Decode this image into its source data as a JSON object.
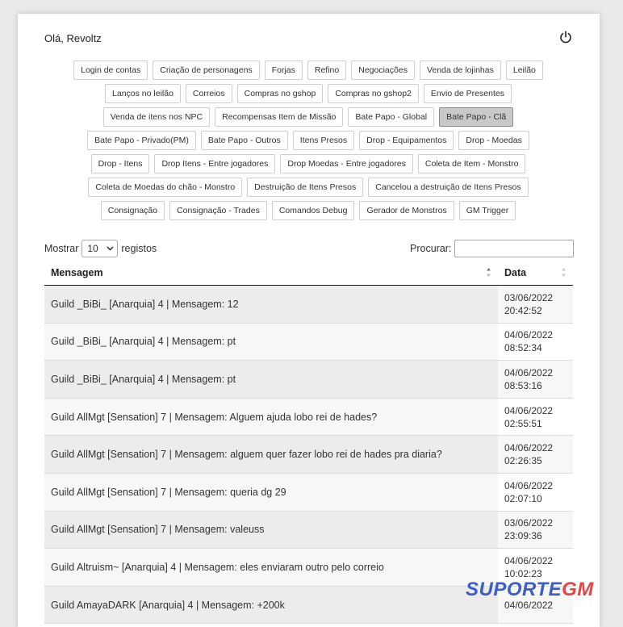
{
  "header": {
    "greeting": "Olá, Revoltz"
  },
  "filters": [
    "Login de contas",
    "Criação de personagens",
    "Forjas",
    "Refino",
    "Negociações",
    "Venda de lojinhas",
    "Leilão",
    "Lanços no leilão",
    "Correios",
    "Compras no gshop",
    "Compras no gshop2",
    "Envio de Presentes",
    "Venda de itens nos NPC",
    "Recompensas Item de Missão",
    "Bate Papo - Global",
    "Bate Papo - Clã",
    "Bate Papo - Privado(PM)",
    "Bate Papo - Outros",
    "Itens Presos",
    "Drop - Equipamentos",
    "Drop - Moedas",
    "Drop - Itens",
    "Drop Itens - Entre jogadores",
    "Drop Moedas - Entre jogadores",
    "Coleta de Item - Monstro",
    "Coleta de Moedas do chão - Monstro",
    "Destruição de Itens Presos",
    "Cancelou a destruição de Itens Presos",
    "Consignação",
    "Consignação - Trades",
    "Comandos Debug",
    "Gerador de Monstros",
    "GM Trigger"
  ],
  "active_filter": "Bate Papo - Clã",
  "length": {
    "prefix": "Mostrar",
    "value": "10",
    "suffix": "registos"
  },
  "search": {
    "label": "Procurar:"
  },
  "table": {
    "headers": {
      "message": "Mensagem",
      "date": "Data"
    },
    "rows": [
      {
        "message": "Guild _BiBi_ [Anarquia] 4 | Mensagem: 12",
        "date": "03/06/2022",
        "time": "20:42:52"
      },
      {
        "message": "Guild _BiBi_ [Anarquia] 4 | Mensagem: pt",
        "date": "04/06/2022",
        "time": "08:52:34"
      },
      {
        "message": "Guild _BiBi_ [Anarquia] 4 | Mensagem: pt",
        "date": "04/06/2022",
        "time": "08:53:16"
      },
      {
        "message": "Guild AllMgt [Sensation] 7 | Mensagem: Alguem ajuda lobo rei de hades?",
        "date": "04/06/2022",
        "time": "02:55:51"
      },
      {
        "message": "Guild AllMgt [Sensation] 7 | Mensagem: alguem quer fazer lobo rei de hades pra diaria?",
        "date": "04/06/2022",
        "time": "02:26:35"
      },
      {
        "message": "Guild AllMgt [Sensation] 7 | Mensagem: queria dg 29",
        "date": "04/06/2022",
        "time": "02:07:10"
      },
      {
        "message": "Guild AllMgt [Sensation] 7 | Mensagem: valeuss",
        "date": "03/06/2022",
        "time": "23:09:36"
      },
      {
        "message": "Guild Altruism~ [Anarquia] 4 | Mensagem: eles enviaram outro pelo correio",
        "date": "04/06/2022",
        "time": "10:02:23"
      },
      {
        "message": "Guild AmayaDARK [Anarquia] 4 | Mensagem: +200k",
        "date": "04/06/2022",
        "time": ""
      }
    ]
  },
  "watermark": {
    "part1": "SUPORTE",
    "part2": "GM"
  },
  "icons": {
    "power": "power-icon",
    "sort": "sort-icon",
    "dropdown": "chevron-down-icon"
  },
  "colors": {
    "active_filter_bg": "#c9c9c9",
    "watermark_blue": "#3d5fc4",
    "watermark_red": "#e04848"
  }
}
